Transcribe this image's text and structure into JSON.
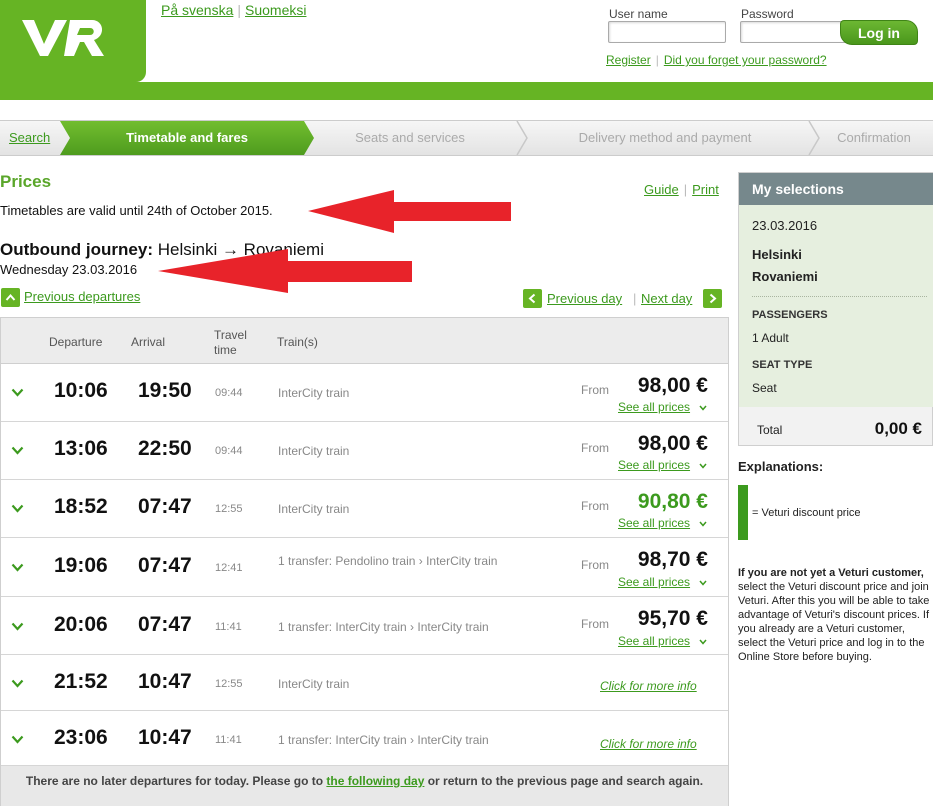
{
  "header": {
    "lang_sv": "På svenska",
    "lang_fi": "Suomeksi",
    "username_label": "User name",
    "password_label": "Password",
    "login_button": "Log in",
    "register_link": "Register",
    "forgot_link": "Did you forget your password?"
  },
  "steps": {
    "search": "Search",
    "timetable": "Timetable and fares",
    "seats": "Seats and services",
    "delivery": "Delivery method and payment",
    "confirmation": "Confirmation"
  },
  "main": {
    "title": "Prices",
    "guide": "Guide",
    "print": "Print",
    "valid_text": "Timetables are valid until 24th of October 2015.",
    "journey_label": "Outbound journey:",
    "journey_route": "Helsinki → Rovaniemi",
    "journey_date": "Wednesday 23.03.2016",
    "prev_departures": "Previous departures",
    "prev_day": "Previous day",
    "next_day": "Next day"
  },
  "table": {
    "headers": {
      "departure": "Departure",
      "arrival": "Arrival",
      "travel_time_1": "Travel",
      "travel_time_2": "time",
      "trains": "Train(s)"
    },
    "rows": [
      {
        "dep": "10:06",
        "arr": "19:50",
        "travel": "09:44",
        "train": "InterCity train",
        "from": "From",
        "price": "98,00 €",
        "see": "See all prices"
      },
      {
        "dep": "13:06",
        "arr": "22:50",
        "travel": "09:44",
        "train": "InterCity train",
        "from": "From",
        "price": "98,00 €",
        "see": "See all prices"
      },
      {
        "dep": "18:52",
        "arr": "07:47",
        "travel": "12:55",
        "train": "InterCity train",
        "from": "From",
        "price": "90,80 €",
        "see": "See all prices"
      },
      {
        "dep": "19:06",
        "arr": "07:47",
        "travel": "12:41",
        "train": "1 transfer: Pendolino train › InterCity train",
        "from": "From",
        "price": "98,70 €",
        "see": "See all prices"
      },
      {
        "dep": "20:06",
        "arr": "07:47",
        "travel": "11:41",
        "train": "1 transfer: InterCity train › InterCity train",
        "from": "From",
        "price": "95,70 €",
        "see": "See all prices"
      },
      {
        "dep": "21:52",
        "arr": "10:47",
        "travel": "12:55",
        "train": "InterCity train",
        "more": "Click for more info"
      },
      {
        "dep": "23:06",
        "arr": "10:47",
        "travel": "11:41",
        "train": "1 transfer: InterCity train › InterCity train",
        "more": "Click for more info"
      }
    ],
    "footer_before": "There are no later departures for today. Please go to ",
    "footer_link": "the following day",
    "footer_after": " or return to the previous page and search again."
  },
  "sidebar": {
    "title": "My selections",
    "date": "23.03.2016",
    "from_station": "Helsinki",
    "to_station": "Rovaniemi",
    "passengers_label": "PASSENGERS",
    "passengers_value": "1 Adult",
    "seat_type_label": "SEAT TYPE",
    "seat_type_value": "Seat",
    "total_label": "Total",
    "total_value": "0,00 €",
    "explanations_title": "Explanations:",
    "discount_text": "= Veturi discount price",
    "veturi_bold": "If you are not yet a Veturi customer,",
    "veturi_text": " select the Veturi discount price and join Veturi. After this you will be able to take advantage of Veturi's discount prices. If you already are a Veturi customer, select the Veturi price and log in to the Online Store before buying."
  },
  "colors": {
    "brand_green": "#66b424",
    "link_green": "#3c9a1e",
    "discount_green": "#3c9a1e",
    "sidebar_header": "#76888c",
    "annotation_arrow": "#e8232a"
  },
  "icons": {
    "logo": "vr-logo",
    "expand": "chevron-down-icon",
    "prev": "chevron-left-icon",
    "next": "chevron-right-icon",
    "up": "chevron-up-icon"
  }
}
